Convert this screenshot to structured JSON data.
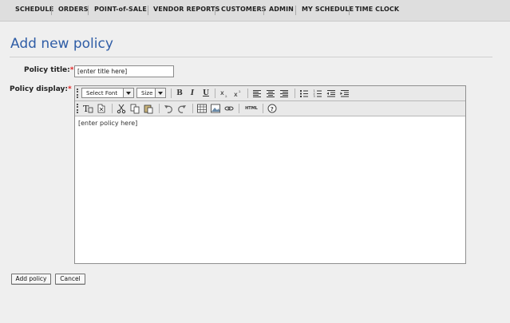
{
  "nav": {
    "items": [
      "SCHEDULE",
      "ORDERS",
      "POINT-of-SALE",
      "VENDOR REPORTS",
      "CUSTOMERS",
      "ADMIN",
      "MY SCHEDULE",
      "TIME CLOCK"
    ]
  },
  "page": {
    "title": "Add new policy"
  },
  "form": {
    "policy_title_label": "Policy title:",
    "policy_title_value": "[enter title here]",
    "policy_display_label": "Policy display:",
    "required_mark": "*"
  },
  "editor": {
    "font_select": "Select Font",
    "size_select": "Size",
    "content": "[enter policy here]",
    "toolbar1_icons": [
      "bold-icon",
      "italic-icon",
      "underline-icon",
      "subscript-icon",
      "superscript-icon",
      "align-left-icon",
      "align-center-icon",
      "align-right-icon",
      "bullet-list-icon",
      "numbered-list-icon",
      "outdent-icon",
      "indent-icon"
    ],
    "toolbar2_icons": [
      "text-format-icon",
      "clear-format-icon",
      "cut-icon",
      "copy-icon",
      "paste-icon",
      "undo-icon",
      "redo-icon",
      "table-icon",
      "image-icon",
      "link-icon",
      "html-icon",
      "help-icon"
    ],
    "bold": "B",
    "italic": "I",
    "underline": "U",
    "html": "HTML"
  },
  "actions": {
    "add_label": "Add policy",
    "cancel_label": "Cancel"
  },
  "colors": {
    "title": "#2f5da6",
    "required": "#e02020"
  }
}
